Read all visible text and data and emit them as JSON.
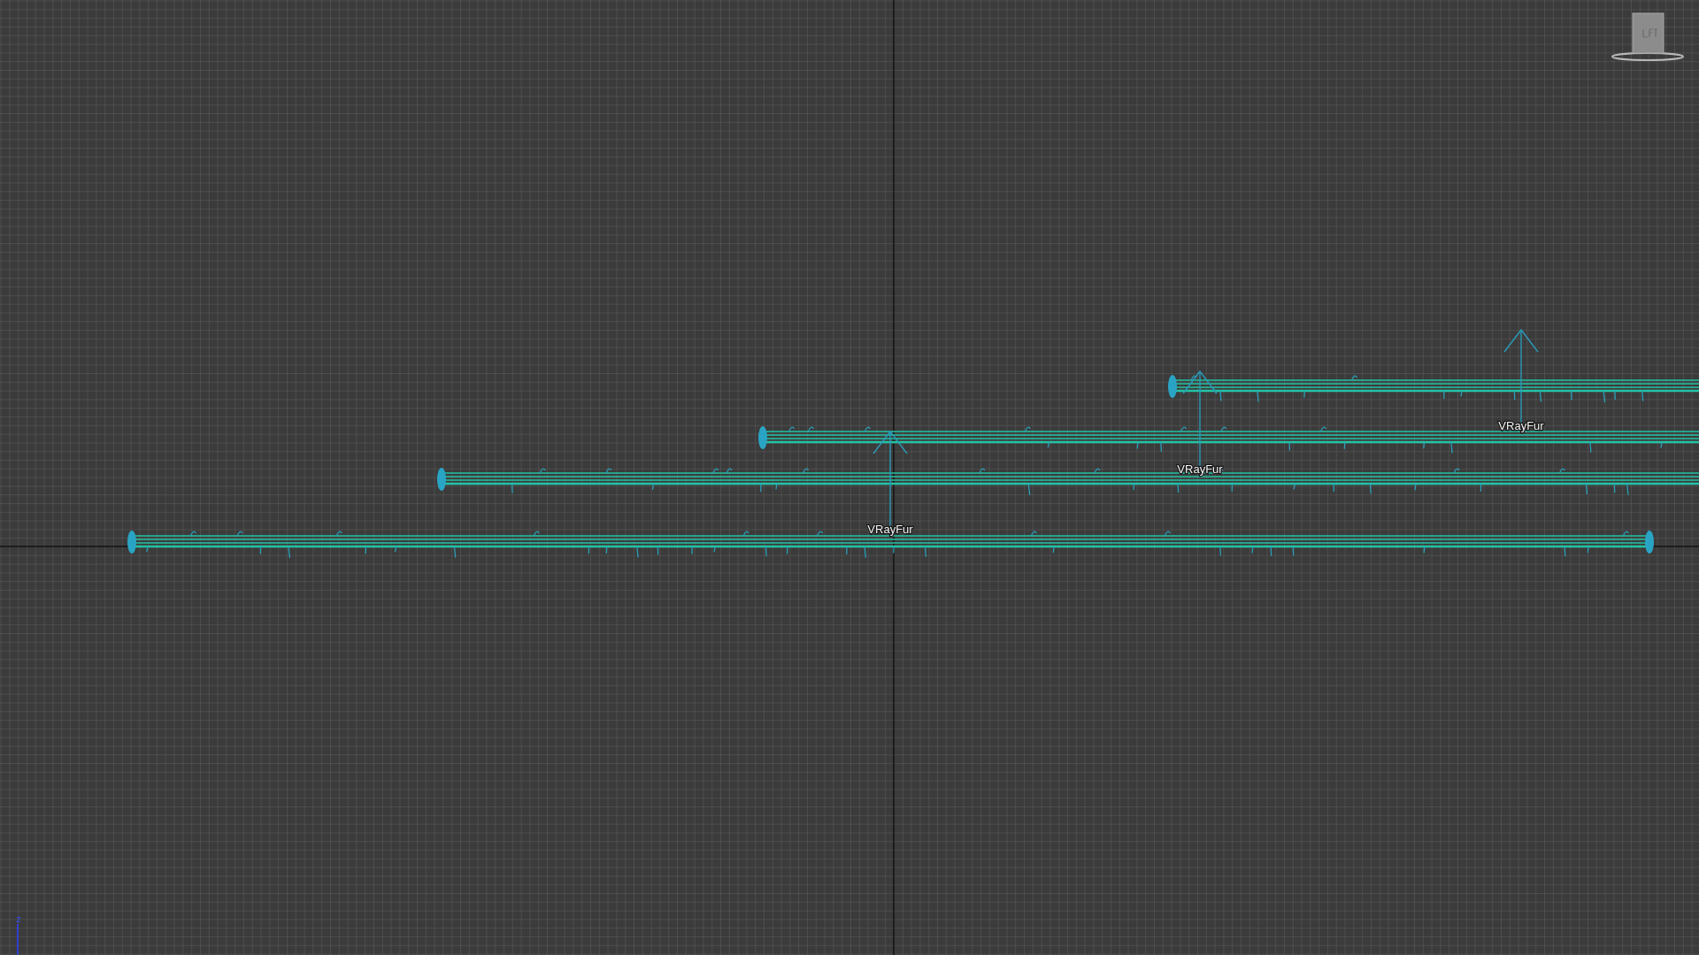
{
  "viewport": {
    "object_labels": [
      "VRayFur",
      "VRayFur",
      "VRayFur"
    ],
    "axis_label": "z"
  }
}
